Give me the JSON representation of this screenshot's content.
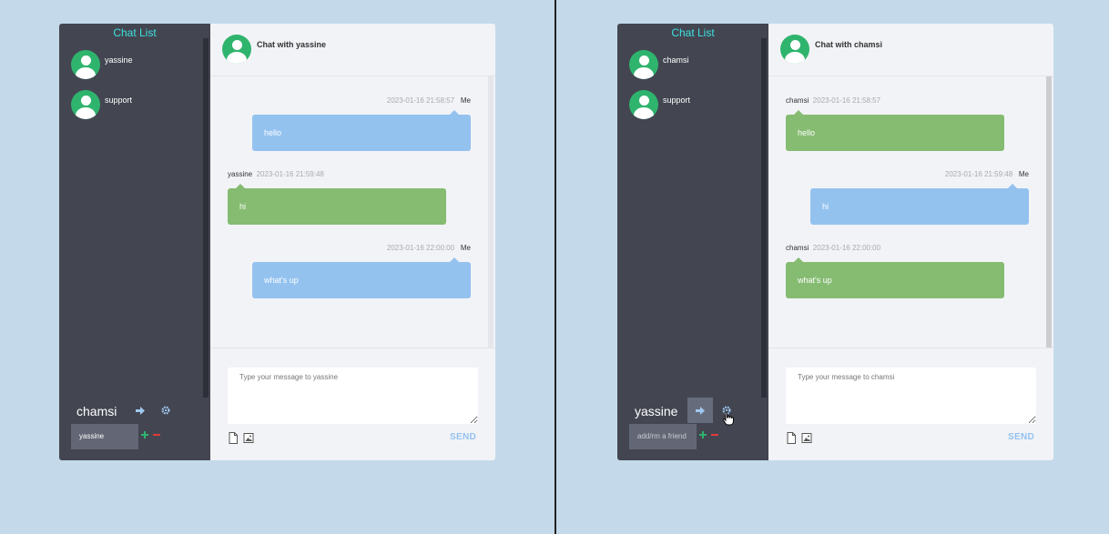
{
  "left_app": {
    "sidebar": {
      "title": "Chat List",
      "contacts": [
        {
          "name": "yassine",
          "icon": "user-avatar-icon"
        },
        {
          "name": "support",
          "icon": "user-avatar-icon"
        }
      ],
      "current_user": "chamsi",
      "friend_input_value": "yassine",
      "friend_input_placeholder": "add/rm a friend"
    },
    "chat": {
      "title": "Chat with yassine",
      "messages": [
        {
          "sender": "Me",
          "timestamp": "2023-01-16 21:58:57",
          "text": "hello",
          "mine": true
        },
        {
          "sender": "yassine",
          "timestamp": "2023-01-16 21:59:48",
          "text": "hi",
          "mine": false
        },
        {
          "sender": "Me",
          "timestamp": "2023-01-16 22:00:00",
          "text": "what's up",
          "mine": true
        }
      ],
      "input_placeholder": "Type your message to yassine",
      "send_label": "SEND"
    }
  },
  "right_app": {
    "sidebar": {
      "title": "Chat List",
      "contacts": [
        {
          "name": "chamsi",
          "icon": "user-avatar-icon"
        },
        {
          "name": "support",
          "icon": "user-avatar-icon"
        }
      ],
      "current_user": "yassine",
      "friend_input_value": "",
      "friend_input_placeholder": "add/rm a friend"
    },
    "chat": {
      "title": "Chat with chamsi",
      "messages": [
        {
          "sender": "chamsi",
          "timestamp": "2023-01-16 21:58:57",
          "text": "hello",
          "mine": false
        },
        {
          "sender": "Me",
          "timestamp": "2023-01-16 21:59:48",
          "text": "hi",
          "mine": true
        },
        {
          "sender": "chamsi",
          "timestamp": "2023-01-16 22:00:00",
          "text": "what's up",
          "mine": false
        }
      ],
      "input_placeholder": "Type your message to chamsi",
      "send_label": "SEND"
    }
  },
  "icons": {
    "logout": "sign-out-icon",
    "settings": "gear-icon",
    "add_friend": "plus-icon",
    "remove_friend": "minus-icon",
    "file": "file-icon",
    "image": "image-icon"
  },
  "colors": {
    "page_bg": "#c4daea",
    "sidebar_bg": "#434651",
    "title_accent": "#3ee1e1",
    "my_bubble": "#93c2ef",
    "their_bubble": "#86bc72",
    "avatar": "#2fb46e",
    "add": "#2fb46e",
    "remove": "#e23a3a"
  }
}
